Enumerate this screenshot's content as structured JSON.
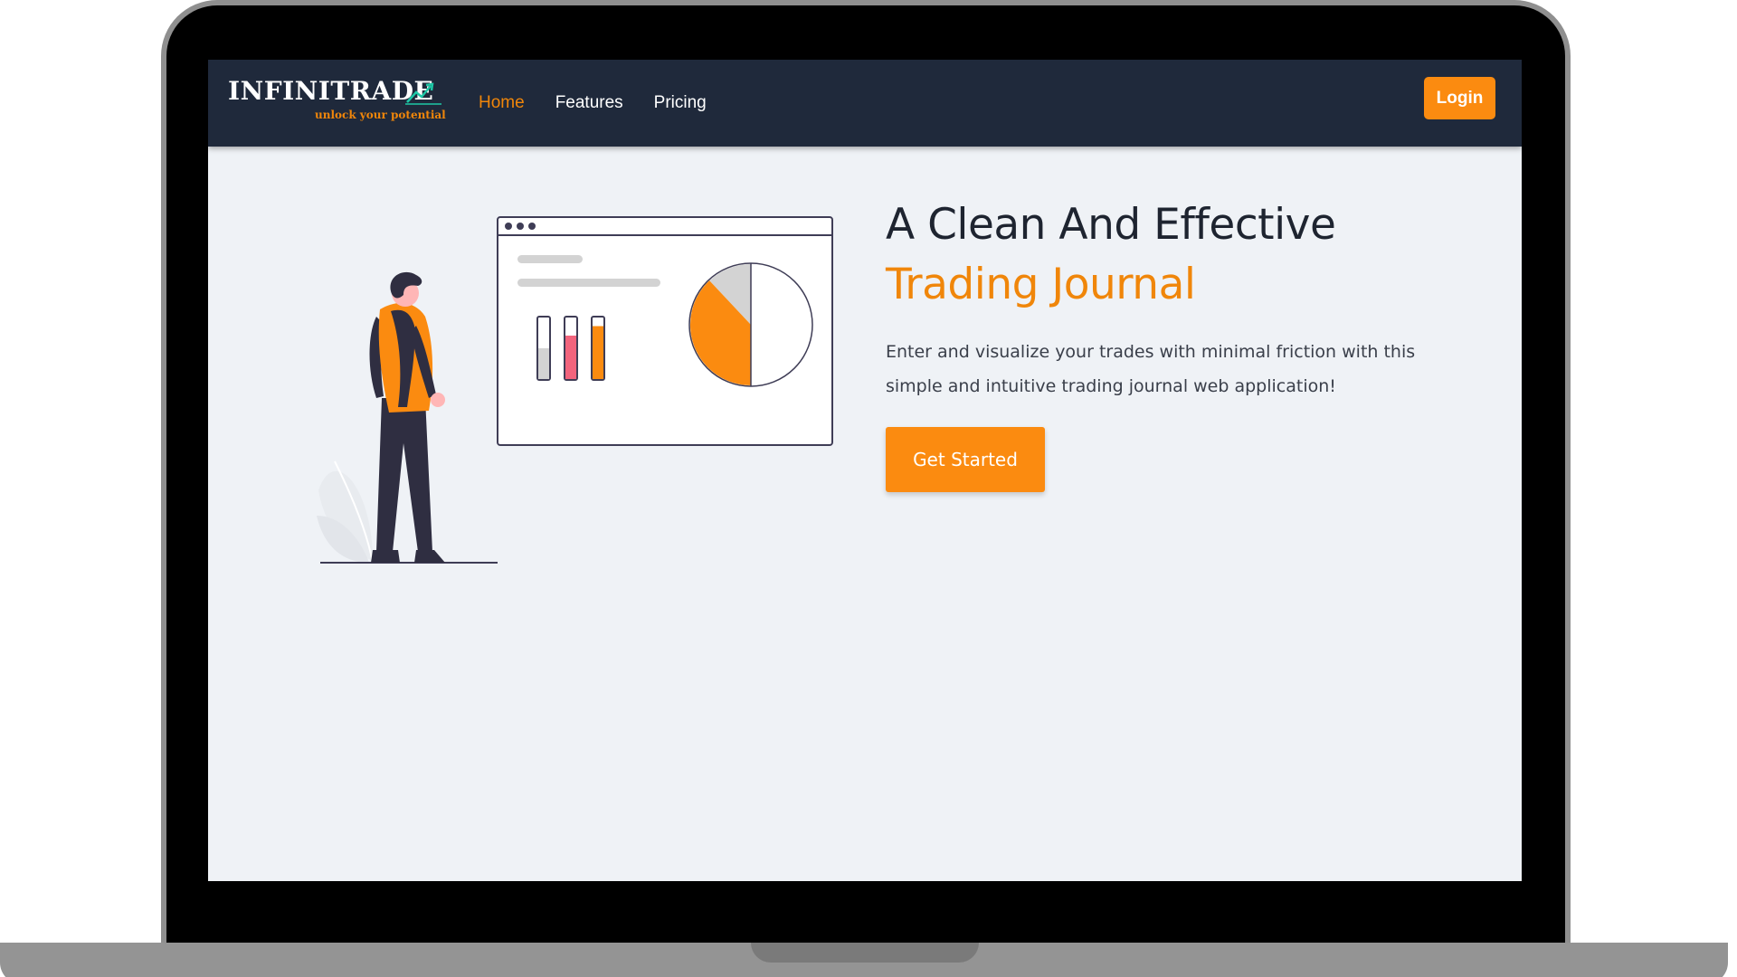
{
  "colors": {
    "accent": "#fb8b10",
    "navbar_bg": "#1f293b",
    "page_bg": "#eff2f6",
    "pink": "#f2647d"
  },
  "brand": {
    "name": "INFINITRADE",
    "tagline": "unlock your potential",
    "logo_icon": "trend-up-chart-icon"
  },
  "nav": {
    "links": [
      {
        "label": "Home",
        "active": true
      },
      {
        "label": "Features",
        "active": false
      },
      {
        "label": "Pricing",
        "active": false
      }
    ],
    "login_label": "Login"
  },
  "hero": {
    "title_line1": "A Clean And Effective",
    "title_line2": "Trading Journal",
    "description": "Enter and visualize your trades with minimal friction with this simple and intuitive trading journal web application!",
    "cta_label": "Get Started"
  },
  "illustration": {
    "bar_fills": [
      0.5,
      0.7,
      0.85
    ],
    "pie_orange_fraction": 0.38,
    "pie_gray_fraction": 0.12
  }
}
